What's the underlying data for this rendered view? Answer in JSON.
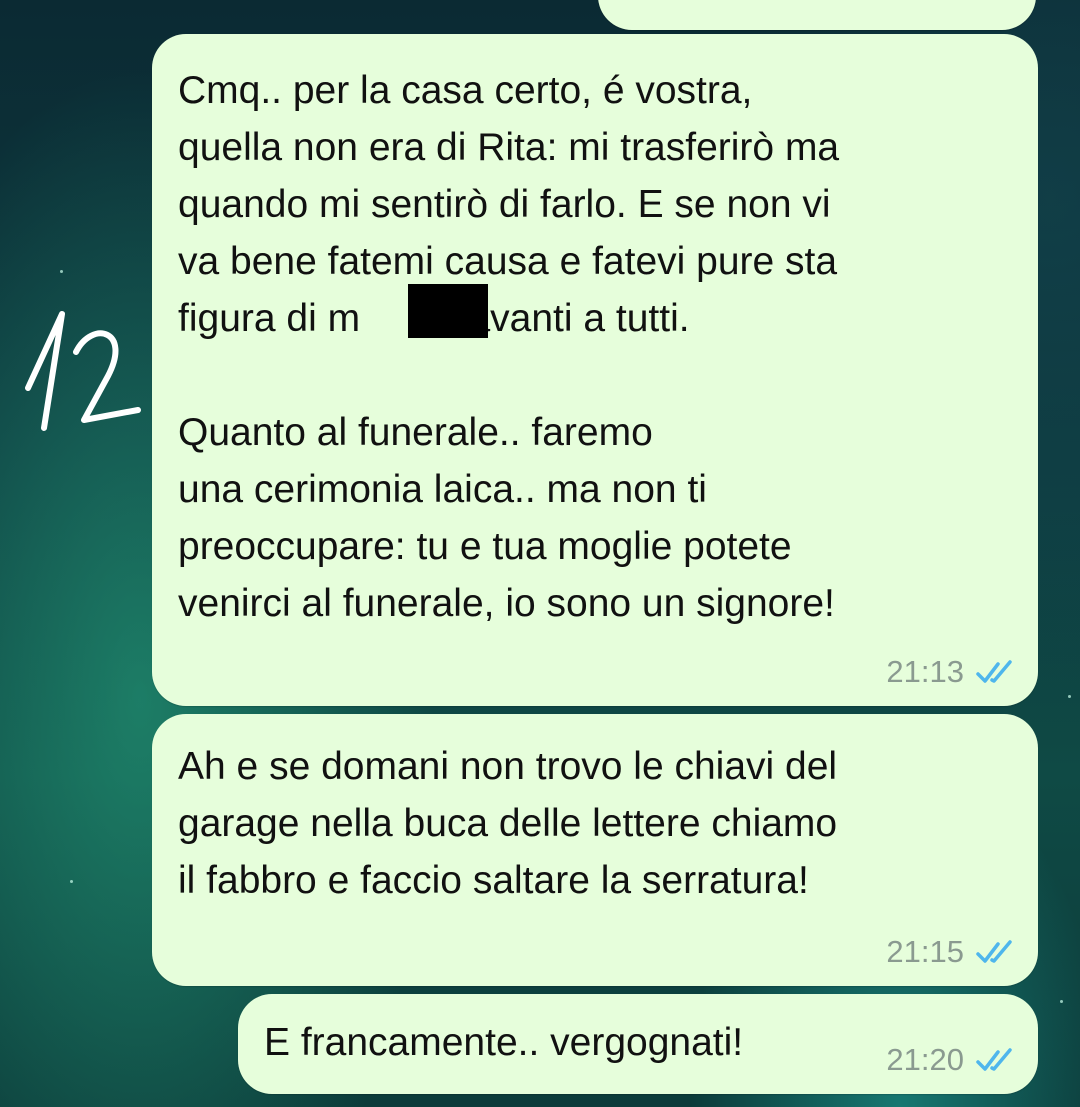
{
  "conversation": {
    "messages": [
      {
        "id": "m1",
        "text": "Cmq.. per la casa certo, é vostra,\nquella non era di Rita: mi trasferirò ma\nquando mi sentirò di farlo. E se non vi\nva bene fatemi causa e fatevi pure sta\nfigura di m     a davanti a tutti.\n\nQuanto al funerale.. faremo\nuna cerimonia laica.. ma non ti\npreoccupare: tu e tua moglie potete\nvenirci al funerale, io sono un signore!",
        "time": "21:13",
        "status": "read"
      },
      {
        "id": "m2",
        "text": "Ah e se domani non trovo le chiavi del\ngarage nella buca delle lettere chiamo\nil fabbro e faccio saltare la serratura!",
        "time": "21:15",
        "status": "read"
      },
      {
        "id": "m3",
        "text": "E francamente.. vergognati!",
        "time": "21:20",
        "status": "read"
      }
    ]
  },
  "annotation": {
    "label": "12"
  },
  "colors": {
    "bubble": "#e6fedb",
    "read_ticks": "#4fb6ec",
    "timestamp": "#8a9a90"
  }
}
